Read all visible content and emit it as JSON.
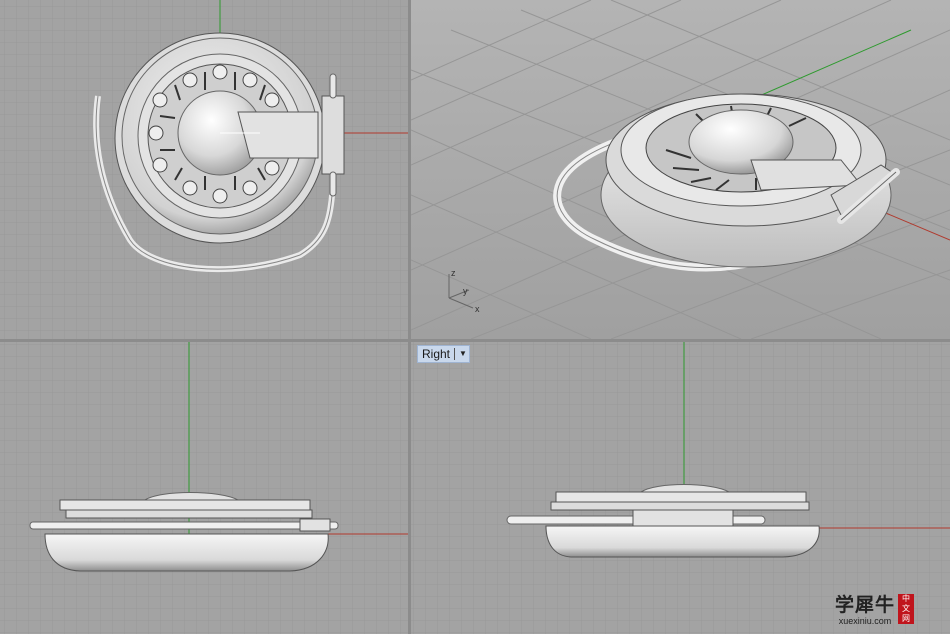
{
  "viewports": {
    "right": {
      "label": "Right"
    }
  },
  "axis_icon": {
    "z": "z",
    "y": "y",
    "x": "x"
  },
  "watermark": {
    "main": "学犀牛",
    "sub": "xuexiniu.com",
    "seal": [
      "中",
      "文",
      "网"
    ]
  },
  "colors": {
    "grid_bg": "#a3a3a3",
    "grid_minor": "#9a9a9a",
    "grid_major": "#8a8a8a",
    "x_axis": "#b03a2e",
    "y_axis": "#2e9a2e",
    "model": "#e6e6e6",
    "tab_bg": "#c9d8ec"
  }
}
